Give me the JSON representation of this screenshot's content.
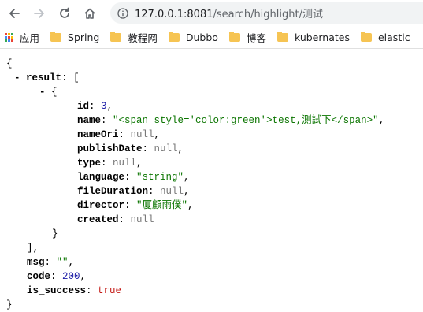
{
  "browser": {
    "url_host": "127.0.0.1:8081",
    "url_path": "/search/highlight/测试",
    "icons": {
      "back": "arrow-left-icon",
      "forward": "arrow-right-icon",
      "reload": "reload-icon",
      "home": "home-icon",
      "site_info": "info-icon"
    }
  },
  "bookmarks": [
    {
      "label": "应用",
      "icon": "apps-grid-icon"
    },
    {
      "label": "Spring",
      "icon": "folder-icon"
    },
    {
      "label": "教程网",
      "icon": "folder-icon"
    },
    {
      "label": "Dubbo",
      "icon": "folder-icon"
    },
    {
      "label": "博客",
      "icon": "folder-icon"
    },
    {
      "label": "kubernates",
      "icon": "folder-icon"
    },
    {
      "label": "elastic",
      "icon": "folder-icon"
    }
  ],
  "json_view": {
    "open_brace": "{",
    "collapse_glyph": "-",
    "result_key": "result",
    "result_open": "[",
    "item_open": "{",
    "fields": [
      {
        "key": "id",
        "value": "3",
        "type": "num"
      },
      {
        "key": "name",
        "value": "\"<span style='color:green'>test,測試下</span>\"",
        "type": "str"
      },
      {
        "key": "nameOri",
        "value": "null",
        "type": "nul"
      },
      {
        "key": "publishDate",
        "value": "null",
        "type": "nul"
      },
      {
        "key": "type",
        "value": "null",
        "type": "nul"
      },
      {
        "key": "language",
        "value": "\"string\"",
        "type": "str"
      },
      {
        "key": "fileDuration",
        "value": "null",
        "type": "nul"
      },
      {
        "key": "director",
        "value": "\"厦顧雨僕\"",
        "type": "str"
      },
      {
        "key": "created",
        "value": "null",
        "type": "nul"
      }
    ],
    "item_close": "}",
    "result_close": "],",
    "msg_key": "msg",
    "msg_value": "\"\"",
    "code_key": "code",
    "code_value": "200",
    "is_success_key": "is_success",
    "is_success_value": "true",
    "close_brace": "}"
  },
  "colors": {
    "number": "#1a1aa6",
    "string": "#0b7500",
    "null": "#777777",
    "boolean": "#c41a16",
    "folder": "#f6c453"
  }
}
